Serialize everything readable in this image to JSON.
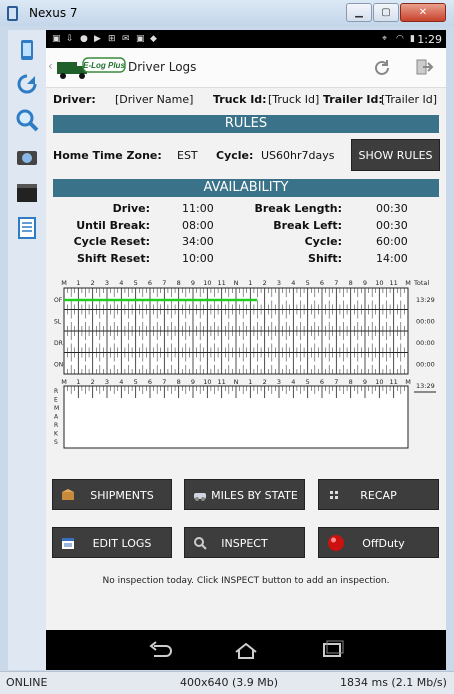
{
  "window": {
    "title": "Nexus 7",
    "min": "▁",
    "max": "▢",
    "close": "✕"
  },
  "status": {
    "time": "1:29"
  },
  "app": {
    "title": "Driver Logs",
    "logo_text": "E-Log Plus"
  },
  "info": {
    "driver_label": "Driver:",
    "driver_value": "[Driver Name]",
    "truck_label": "Truck Id:",
    "truck_value": "[Truck Id]",
    "trailer_label": "Trailer Id:",
    "trailer_value": "[Trailer Id]"
  },
  "rules": {
    "header": "RULES",
    "tz_label": "Home Time Zone:",
    "tz_value": "EST",
    "cycle_label": "Cycle:",
    "cycle_value": "US60hr7days",
    "show_rules": "SHOW RULES"
  },
  "availability": {
    "header": "AVAILABILITY",
    "left": [
      {
        "label": "Drive:",
        "value": "11:00"
      },
      {
        "label": "Until Break:",
        "value": "08:00"
      },
      {
        "label": "Cycle Reset:",
        "value": "34:00"
      },
      {
        "label": "Shift Reset:",
        "value": "10:00"
      }
    ],
    "right": [
      {
        "label": "Break Length:",
        "value": "00:30"
      },
      {
        "label": "Break Left:",
        "value": "00:30"
      },
      {
        "label": "Cycle:",
        "value": "60:00"
      },
      {
        "label": "Shift:",
        "value": "14:00"
      }
    ]
  },
  "log_grid": {
    "hours": [
      "M",
      "1",
      "2",
      "3",
      "4",
      "5",
      "6",
      "7",
      "8",
      "9",
      "10",
      "11",
      "N",
      "1",
      "2",
      "3",
      "4",
      "5",
      "6",
      "7",
      "8",
      "9",
      "10",
      "11",
      "M"
    ],
    "total_label": "Total",
    "rows": [
      {
        "status": "OF",
        "total": "13:29"
      },
      {
        "status": "SL",
        "total": "00:00"
      },
      {
        "status": "DR",
        "total": "00:00"
      },
      {
        "status": "ON",
        "total": "00:00"
      }
    ],
    "remarks_letters": [
      "R",
      "E",
      "M",
      "A",
      "R",
      "K",
      "S"
    ],
    "remarks_total": "13:29",
    "off_duty_hours": 13.48,
    "line_color": "#22cc22"
  },
  "buttons": {
    "shipments": "SHIPMENTS",
    "miles": "MILES BY STATE",
    "recap": "RECAP",
    "edit_logs": "EDIT LOGS",
    "inspect": "INSPECT",
    "offduty": "OffDuty"
  },
  "note": "No inspection today. Click INSPECT button to add an inspection.",
  "bottom_bar": {
    "status": "ONLINE",
    "resolution": "400x640 (3.9 Mb)",
    "timing": "1834 ms (2.1 Mb/s)"
  }
}
